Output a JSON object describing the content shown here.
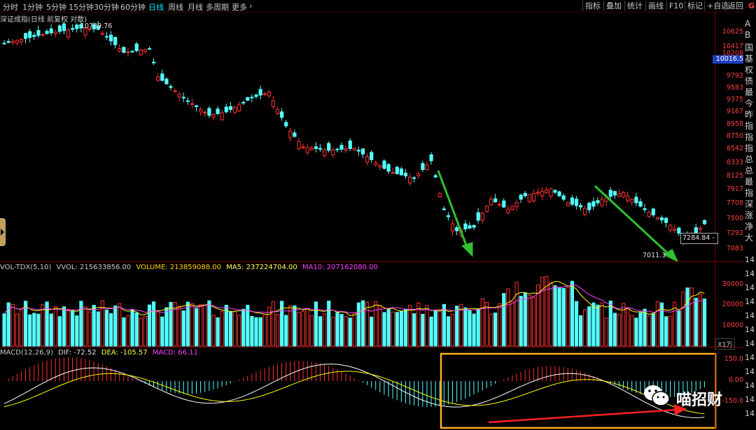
{
  "toolbar": {
    "timeframes": [
      "分时",
      "1分钟",
      "5分钟",
      "15分钟",
      "30分钟",
      "60分钟",
      "日线",
      "周线",
      "月线",
      "多周期",
      "更多"
    ],
    "active_timeframe": "日线",
    "more_arrow": "›",
    "right_tools": [
      "指标",
      "叠加",
      "统计",
      "画线",
      "F10",
      "标记",
      "+自选",
      "返回"
    ],
    "corner": "G"
  },
  "price_panel": {
    "title": "深证成指(日线 前复权 对数)",
    "high_label": "10789.76",
    "low_label": "7011.3",
    "current_tag": "7284.84 -",
    "current_price_box": "10016.5",
    "scale": [
      "10625",
      "10417",
      "10208",
      "10000",
      "9792",
      "9583",
      "9375",
      "9167",
      "8958",
      "8750",
      "8542",
      "8333",
      "8125",
      "7917",
      "7708",
      "7500",
      "7292",
      "7083"
    ]
  },
  "volume_panel": {
    "title": "VOL-TDX(5,10)",
    "vvol": "VVOL: 215633856.00",
    "volume": "VOLUME: 213859088.00",
    "ma5": "MA5: 237224704.00",
    "ma10": "MA10: 207162080.00",
    "scale": [
      "30000",
      "20000",
      "10000"
    ],
    "unit": "X1万"
  },
  "macd_panel": {
    "title": "MACD(12,26,9)",
    "dif": "DIF: -72.52",
    "dea": "DEA: -105.57",
    "macd": "MACD: 66.11",
    "scale": [
      "150.0",
      "0.00",
      "-150.0"
    ]
  },
  "info_column": {
    "chars": [
      "A",
      "B",
      "国",
      "基",
      "权",
      "债",
      "最",
      "今",
      "昨",
      "指",
      "指",
      "指",
      "总",
      "总",
      "最",
      "指",
      "深",
      "涨",
      "净",
      "大"
    ],
    "lower_values": [
      "14",
      "14",
      "14",
      "14",
      "14",
      "14",
      "14",
      "14",
      "14",
      "14",
      "14",
      "14"
    ]
  },
  "watermark": {
    "text": "喵招财"
  },
  "colors": {
    "up": "#ff3030",
    "down": "#54ffff",
    "arrow_green": "#30c030",
    "arrow_red": "#ff2020",
    "highlight_box": "#ffb020",
    "dif_line": "#ffffff",
    "dea_line": "#ffff00",
    "ma_line": "#ff40ff"
  }
}
